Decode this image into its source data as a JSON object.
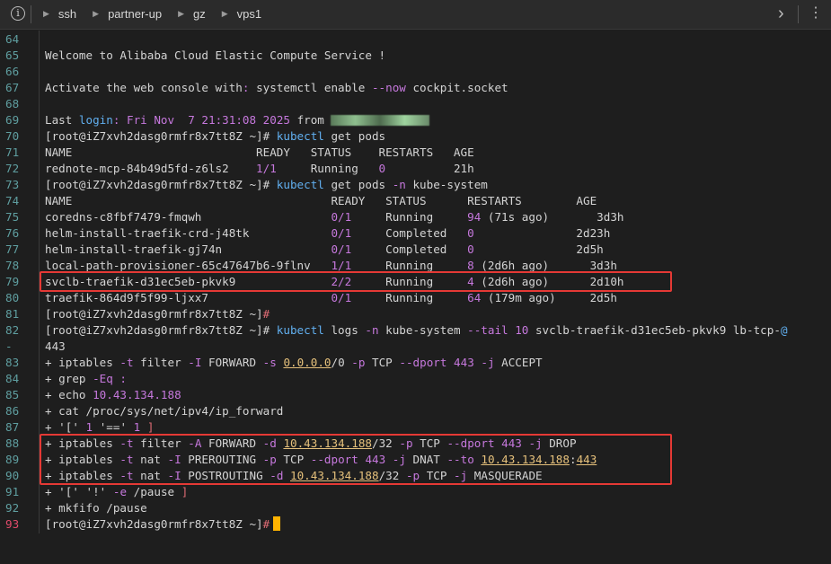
{
  "topbar": {
    "crumbs": [
      "ssh",
      "partner-up",
      "gz",
      "vps1"
    ]
  },
  "lines": [
    {
      "n": "64",
      "parts": []
    },
    {
      "n": "65",
      "parts": [
        {
          "t": "Welcome to Alibaba Cloud Elastic Compute Service !",
          "c": ""
        }
      ]
    },
    {
      "n": "66",
      "parts": []
    },
    {
      "n": "67",
      "parts": [
        {
          "t": "Activate the web console with",
          "c": ""
        },
        {
          "t": ":",
          "c": "val-purple"
        },
        {
          "t": " systemctl enable ",
          "c": ""
        },
        {
          "t": "--now",
          "c": "val-purple"
        },
        {
          "t": " cockpit.socket",
          "c": ""
        }
      ]
    },
    {
      "n": "68",
      "parts": []
    },
    {
      "n": "69",
      "parts": [
        {
          "t": "Last ",
          "c": ""
        },
        {
          "t": "login",
          "c": "cmd"
        },
        {
          "t": ": Fri Nov  7 21:31:08 2025 ",
          "c": "val-purple"
        },
        {
          "t": "from ",
          "c": ""
        },
        {
          "t": "",
          "c": "masked"
        }
      ]
    },
    {
      "n": "70",
      "parts": [
        {
          "t": "[root@iZ7xvh2dasg0rmfr8x7tt8Z ~]# ",
          "c": "prompt"
        },
        {
          "t": "kubectl",
          "c": "cmd"
        },
        {
          "t": " get pods",
          "c": ""
        }
      ]
    },
    {
      "n": "71",
      "parts": [
        {
          "t": "NAME                           READY   STATUS    RESTARTS   AGE",
          "c": ""
        }
      ]
    },
    {
      "n": "72",
      "parts": [
        {
          "t": "rednote-mcp-84b49d5fd-z6ls2    ",
          "c": ""
        },
        {
          "t": "1/1",
          "c": "val-purple"
        },
        {
          "t": "     Running   ",
          "c": ""
        },
        {
          "t": "0",
          "c": "val-purple"
        },
        {
          "t": "          21h",
          "c": ""
        }
      ]
    },
    {
      "n": "73",
      "parts": [
        {
          "t": "[root@iZ7xvh2dasg0rmfr8x7tt8Z ~]# ",
          "c": "prompt"
        },
        {
          "t": "kubectl",
          "c": "cmd"
        },
        {
          "t": " get pods ",
          "c": ""
        },
        {
          "t": "-n",
          "c": "val-purple"
        },
        {
          "t": " kube-system",
          "c": ""
        }
      ]
    },
    {
      "n": "74",
      "parts": [
        {
          "t": "NAME                                      READY   STATUS      RESTARTS        AGE",
          "c": ""
        }
      ]
    },
    {
      "n": "75",
      "parts": [
        {
          "t": "coredns-c8fbf7479-fmqwh                   ",
          "c": ""
        },
        {
          "t": "0/1",
          "c": "val-purple"
        },
        {
          "t": "     Running     ",
          "c": ""
        },
        {
          "t": "94",
          "c": "val-purple"
        },
        {
          "t": " (71s ago)       3d3h",
          "c": ""
        }
      ]
    },
    {
      "n": "76",
      "parts": [
        {
          "t": "helm-install-traefik-crd-j48tk            ",
          "c": ""
        },
        {
          "t": "0/1",
          "c": "val-purple"
        },
        {
          "t": "     Completed   ",
          "c": ""
        },
        {
          "t": "0",
          "c": "val-purple"
        },
        {
          "t": "               2d23h",
          "c": ""
        }
      ]
    },
    {
      "n": "77",
      "parts": [
        {
          "t": "helm-install-traefik-gj74n                ",
          "c": ""
        },
        {
          "t": "0/1",
          "c": "val-purple"
        },
        {
          "t": "     Completed   ",
          "c": ""
        },
        {
          "t": "0",
          "c": "val-purple"
        },
        {
          "t": "               2d5h",
          "c": ""
        }
      ]
    },
    {
      "n": "78",
      "parts": [
        {
          "t": "local-path-provisioner-65c47647b6-9flnv   ",
          "c": ""
        },
        {
          "t": "1/1",
          "c": "val-purple"
        },
        {
          "t": "     Running     ",
          "c": ""
        },
        {
          "t": "8",
          "c": "val-purple"
        },
        {
          "t": " (2d6h ago)      3d3h",
          "c": ""
        }
      ]
    },
    {
      "n": "79",
      "parts": [
        {
          "t": "svclb-traefik-d31ec5eb-pkvk9              ",
          "c": ""
        },
        {
          "t": "2/2",
          "c": "val-purple"
        },
        {
          "t": "     Running     ",
          "c": ""
        },
        {
          "t": "4",
          "c": "val-purple"
        },
        {
          "t": " (2d6h ago)      2d10h",
          "c": ""
        }
      ]
    },
    {
      "n": "80",
      "parts": [
        {
          "t": "traefik-864d9f5f99-ljxx7                  ",
          "c": ""
        },
        {
          "t": "0/1",
          "c": "val-purple"
        },
        {
          "t": "     Running     ",
          "c": ""
        },
        {
          "t": "64",
          "c": "val-purple"
        },
        {
          "t": " (179m ago)     2d5h",
          "c": ""
        }
      ]
    },
    {
      "n": "81",
      "parts": [
        {
          "t": "[root@iZ7xvh2dasg0rmfr8x7tt8Z ~]",
          "c": "prompt"
        },
        {
          "t": "#",
          "c": "red"
        }
      ]
    },
    {
      "n": "82",
      "parts": [
        {
          "t": "[root@iZ7xvh2dasg0rmfr8x7tt8Z ~]# ",
          "c": "prompt"
        },
        {
          "t": "kubectl",
          "c": "cmd"
        },
        {
          "t": " logs ",
          "c": ""
        },
        {
          "t": "-n",
          "c": "val-purple"
        },
        {
          "t": " kube-system ",
          "c": ""
        },
        {
          "t": "--tail",
          "c": "val-purple"
        },
        {
          "t": " ",
          "c": ""
        },
        {
          "t": "10",
          "c": "val-purple"
        },
        {
          "t": " svclb-traefik-d31ec5eb-pkvk9 lb-tcp-",
          "c": ""
        },
        {
          "t": "@",
          "c": "cmd"
        }
      ]
    },
    {
      "n": "-",
      "parts": [
        {
          "t": "443",
          "c": ""
        }
      ]
    },
    {
      "n": "83",
      "parts": [
        {
          "t": "+ iptables ",
          "c": ""
        },
        {
          "t": "-t",
          "c": "val-purple"
        },
        {
          "t": " filter ",
          "c": ""
        },
        {
          "t": "-I",
          "c": "val-purple"
        },
        {
          "t": " FORWARD ",
          "c": ""
        },
        {
          "t": "-s",
          "c": "val-purple"
        },
        {
          "t": " ",
          "c": ""
        },
        {
          "t": "0.0.0.0",
          "c": "val-yellow"
        },
        {
          "t": "/0 ",
          "c": ""
        },
        {
          "t": "-p",
          "c": "val-purple"
        },
        {
          "t": " TCP ",
          "c": ""
        },
        {
          "t": "--dport",
          "c": "val-purple"
        },
        {
          "t": " ",
          "c": ""
        },
        {
          "t": "443",
          "c": "val-purple"
        },
        {
          "t": " ",
          "c": ""
        },
        {
          "t": "-j",
          "c": "val-purple"
        },
        {
          "t": " ACCEPT",
          "c": ""
        }
      ]
    },
    {
      "n": "84",
      "parts": [
        {
          "t": "+ grep ",
          "c": ""
        },
        {
          "t": "-Eq",
          "c": "val-purple"
        },
        {
          "t": " ",
          "c": ""
        },
        {
          "t": ":",
          "c": "val-purple"
        }
      ]
    },
    {
      "n": "85",
      "parts": [
        {
          "t": "+ echo ",
          "c": ""
        },
        {
          "t": "10.43.134.188",
          "c": "val-purple"
        }
      ]
    },
    {
      "n": "86",
      "parts": [
        {
          "t": "+ cat /proc/sys/net/ipv4/ip_forward",
          "c": ""
        }
      ]
    },
    {
      "n": "87",
      "parts": [
        {
          "t": "+ ",
          "c": ""
        },
        {
          "t": "'['",
          "c": ""
        },
        {
          "t": " ",
          "c": ""
        },
        {
          "t": "1",
          "c": "val-purple"
        },
        {
          "t": " ",
          "c": ""
        },
        {
          "t": "'=='",
          "c": ""
        },
        {
          "t": " ",
          "c": ""
        },
        {
          "t": "1",
          "c": "val-purple"
        },
        {
          "t": " ",
          "c": ""
        },
        {
          "t": "]",
          "c": "red"
        }
      ]
    },
    {
      "n": "88",
      "parts": [
        {
          "t": "+ iptables ",
          "c": ""
        },
        {
          "t": "-t",
          "c": "val-purple"
        },
        {
          "t": " filter ",
          "c": ""
        },
        {
          "t": "-A",
          "c": "val-purple"
        },
        {
          "t": " FORWARD ",
          "c": ""
        },
        {
          "t": "-d",
          "c": "val-purple"
        },
        {
          "t": " ",
          "c": ""
        },
        {
          "t": "10.43.134.188",
          "c": "val-yellow"
        },
        {
          "t": "/32 ",
          "c": ""
        },
        {
          "t": "-p",
          "c": "val-purple"
        },
        {
          "t": " TCP ",
          "c": ""
        },
        {
          "t": "--dport",
          "c": "val-purple"
        },
        {
          "t": " ",
          "c": ""
        },
        {
          "t": "443",
          "c": "val-purple"
        },
        {
          "t": " ",
          "c": ""
        },
        {
          "t": "-j",
          "c": "val-purple"
        },
        {
          "t": " DROP",
          "c": ""
        }
      ]
    },
    {
      "n": "89",
      "parts": [
        {
          "t": "+ iptables ",
          "c": ""
        },
        {
          "t": "-t",
          "c": "val-purple"
        },
        {
          "t": " nat ",
          "c": ""
        },
        {
          "t": "-I",
          "c": "val-purple"
        },
        {
          "t": " PREROUTING ",
          "c": ""
        },
        {
          "t": "-p",
          "c": "val-purple"
        },
        {
          "t": " TCP ",
          "c": ""
        },
        {
          "t": "--dport",
          "c": "val-purple"
        },
        {
          "t": " ",
          "c": ""
        },
        {
          "t": "443",
          "c": "val-purple"
        },
        {
          "t": " ",
          "c": ""
        },
        {
          "t": "-j",
          "c": "val-purple"
        },
        {
          "t": " DNAT ",
          "c": ""
        },
        {
          "t": "--to",
          "c": "val-purple"
        },
        {
          "t": " ",
          "c": ""
        },
        {
          "t": "10.43.134.188",
          "c": "val-yellow"
        },
        {
          "t": ":",
          "c": ""
        },
        {
          "t": "443",
          "c": "val-yellow"
        }
      ]
    },
    {
      "n": "90",
      "parts": [
        {
          "t": "+ iptables ",
          "c": ""
        },
        {
          "t": "-t",
          "c": "val-purple"
        },
        {
          "t": " nat ",
          "c": ""
        },
        {
          "t": "-I",
          "c": "val-purple"
        },
        {
          "t": " POSTROUTING ",
          "c": ""
        },
        {
          "t": "-d",
          "c": "val-purple"
        },
        {
          "t": " ",
          "c": ""
        },
        {
          "t": "10.43.134.188",
          "c": "val-yellow"
        },
        {
          "t": "/32 ",
          "c": ""
        },
        {
          "t": "-p",
          "c": "val-purple"
        },
        {
          "t": " TCP ",
          "c": ""
        },
        {
          "t": "-j",
          "c": "val-purple"
        },
        {
          "t": " MASQUERADE",
          "c": ""
        }
      ]
    },
    {
      "n": "91",
      "parts": [
        {
          "t": "+ ",
          "c": ""
        },
        {
          "t": "'['",
          "c": ""
        },
        {
          "t": " ",
          "c": ""
        },
        {
          "t": "'!'",
          "c": ""
        },
        {
          "t": " ",
          "c": ""
        },
        {
          "t": "-e",
          "c": "val-purple"
        },
        {
          "t": " /pause ",
          "c": ""
        },
        {
          "t": "]",
          "c": "red"
        }
      ]
    },
    {
      "n": "92",
      "parts": [
        {
          "t": "+ mkfifo /pause",
          "c": ""
        }
      ]
    },
    {
      "n": "93",
      "parts": [
        {
          "t": "[root@iZ7xvh2dasg0rmfr8x7tt8Z ~]",
          "c": "prompt"
        },
        {
          "t": "#",
          "c": "red"
        }
      ],
      "cursor": true
    }
  ],
  "colors": {
    "background": "#1e1e1e",
    "accent_box": "#e53935",
    "cursor": "#ffb300",
    "command": "#61afef",
    "flag": "#c678dd",
    "underlined_value": "#e5c07b"
  }
}
